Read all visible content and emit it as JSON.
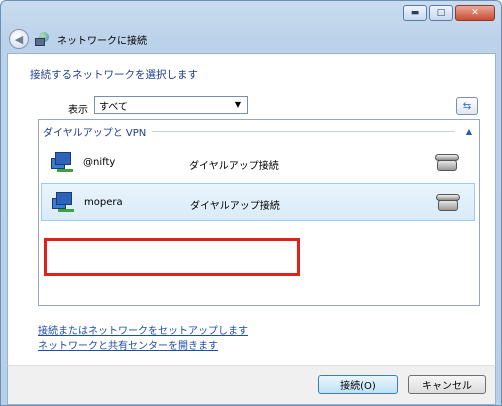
{
  "window": {
    "title": "ネットワークに接続",
    "controls": {
      "minimize": "▬",
      "maximize": "□",
      "close": "✕"
    },
    "back_icon": "back-arrow-icon",
    "title_icon": "network-globe-icon"
  },
  "main": {
    "heading": "接続するネットワークを選択します",
    "show_label": "表示",
    "show_value": "すべて",
    "refresh_icon": "refresh-icon"
  },
  "list": {
    "group_title": "ダイヤルアップと VPN",
    "rows": [
      {
        "name": "@nifty",
        "type": "ダイヤルアップ接続",
        "icon": "dialup-connection-icon",
        "device_icon": "phone-icon"
      },
      {
        "name": "mopera",
        "type": "ダイヤルアップ接続",
        "icon": "dialup-connection-icon",
        "device_icon": "phone-icon",
        "selected": true
      }
    ]
  },
  "links": {
    "setup": "接続またはネットワークをセットアップします",
    "center": "ネットワークと共有センターを開きます"
  },
  "footer": {
    "connect": "接続(O)",
    "cancel": "キャンセル"
  },
  "colors": {
    "highlight_border": "#e0201a",
    "link": "#1f4ea8",
    "heading": "#1e3c8c"
  }
}
